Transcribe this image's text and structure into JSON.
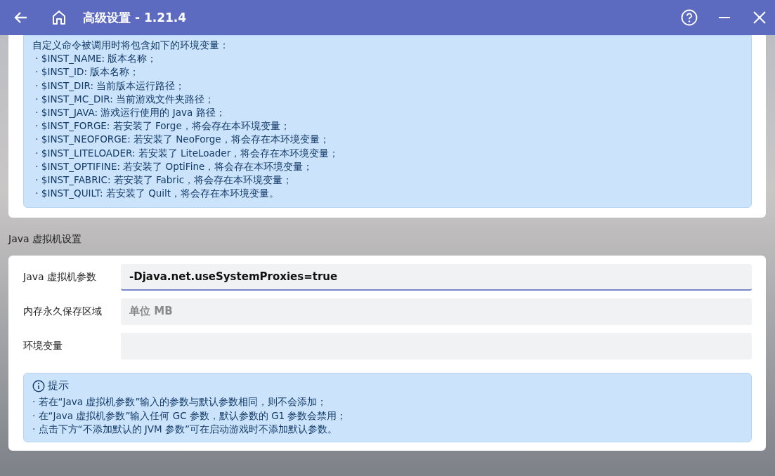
{
  "title_bar": {
    "title": "高级设置 - 1.21.4"
  },
  "env_hint": {
    "lines": [
      "自定义命令被调用时将包含如下的环境变量：",
      " · $INST_NAME: 版本名称；",
      " · $INST_ID: 版本名称；",
      " · $INST_DIR: 当前版本运行路径；",
      " · $INST_MC_DIR: 当前游戏文件夹路径；",
      " · $INST_JAVA: 游戏运行使用的 Java 路径；",
      " · $INST_FORGE: 若安装了 Forge，将会存在本环境变量；",
      " · $INST_NEOFORGE: 若安装了 NeoForge，将会存在本环境变量；",
      " · $INST_LITELOADER: 若安装了 LiteLoader，将会存在本环境变量；",
      " · $INST_OPTIFINE: 若安装了 OptiFine，将会存在本环境变量；",
      " · $INST_FABRIC: 若安装了 Fabric，将会存在本环境变量；",
      " · $INST_QUILT: 若安装了 Quilt，将会存在本环境变量。"
    ]
  },
  "jvm_section": {
    "heading": "Java 虚拟机设置",
    "fields": [
      {
        "label": "Java 虚拟机参数",
        "value": "-Djava.net.useSystemProxies=true",
        "focused": true
      },
      {
        "label": "内存永久保存区域",
        "placeholder": "单位 MB",
        "focused": false
      },
      {
        "label": "环境变量",
        "focused": false
      }
    ],
    "hint": {
      "title": "提示",
      "lines": [
        "· 若在“Java 虚拟机参数”输入的参数与默认参数相同，则不会添加；",
        "· 在“Java 虚拟机参数”输入任何 GC 参数，默认参数的 G1 参数会禁用；",
        "· 点击下方“不添加默认的 JVM 参数”可在启动游戏时不添加默认参数。"
      ]
    }
  }
}
